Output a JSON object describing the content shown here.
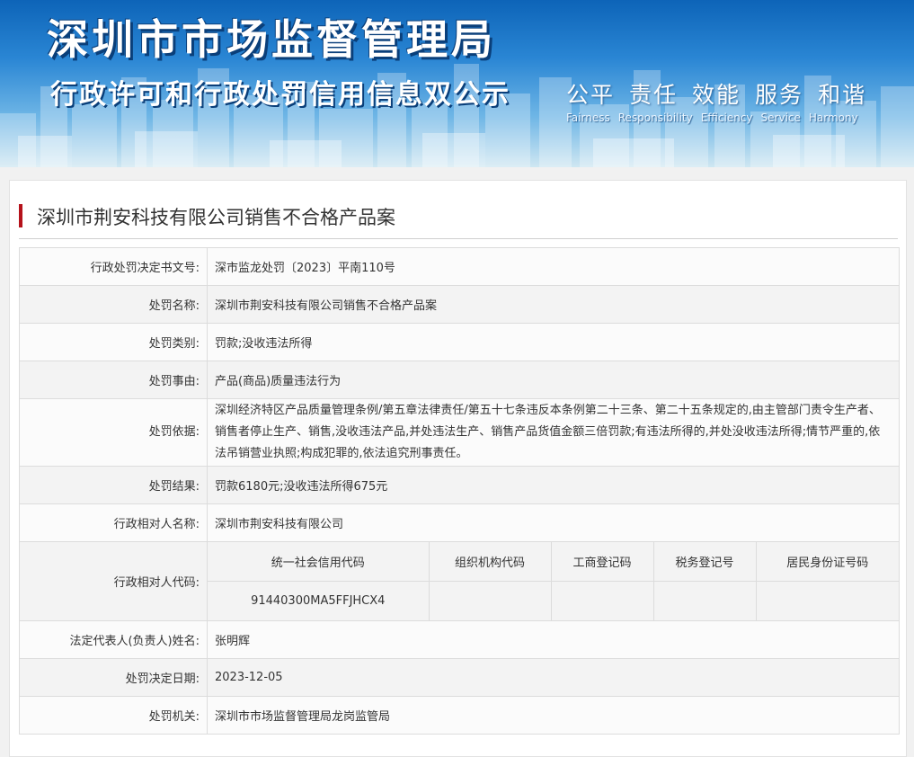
{
  "header": {
    "agency_name": "深圳市市场监督管理局",
    "subtitle": "行政许可和行政处罚信用信息双公示",
    "slogans_cn": [
      "公平",
      "责任",
      "效能",
      "服务",
      "和谐"
    ],
    "slogans_en": [
      "Fairness",
      "Responsibility",
      "Efficiency",
      "Service",
      "Harmony"
    ]
  },
  "case": {
    "title": "深圳市荆安科技有限公司销售不合格产品案",
    "fields": [
      {
        "label": "行政处罚决定书文号:",
        "value": "深市监龙处罚〔2023〕平南110号"
      },
      {
        "label": "处罚名称:",
        "value": "深圳市荆安科技有限公司销售不合格产品案"
      },
      {
        "label": "处罚类别:",
        "value": "罚款;没收违法所得"
      },
      {
        "label": "处罚事由:",
        "value": "产品(商品)质量违法行为"
      },
      {
        "label": "处罚依据:",
        "value": "深圳经济特区产品质量管理条例/第五章法律责任/第五十七条违反本条例第二十三条、第二十五条规定的,由主管部门责令生产者、销售者停止生产、销售,没收违法产品,并处违法生产、销售产品货值金额三倍罚款;有违法所得的,并处没收违法所得;情节严重的,依法吊销营业执照;构成犯罪的,依法追究刑事责任。"
      },
      {
        "label": "处罚结果:",
        "value": "罚款6180元;没收违法所得675元"
      },
      {
        "label": "行政相对人名称:",
        "value": "深圳市荆安科技有限公司"
      }
    ],
    "codes": {
      "label": "行政相对人代码:",
      "headers": [
        "统一社会信用代码",
        "组织机构代码",
        "工商登记码",
        "税务登记号",
        "居民身份证号码"
      ],
      "values": [
        "91440300MA5FFJHCX4",
        "",
        "",
        "",
        ""
      ]
    },
    "fields2": [
      {
        "label": "法定代表人(负责人)姓名:",
        "value": "张明辉"
      },
      {
        "label": "处罚决定日期:",
        "value": "2023-12-05"
      },
      {
        "label": "处罚机关:",
        "value": "深圳市市场监督管理局龙岗监管局"
      }
    ]
  },
  "colors": {
    "accent_bar": "#b5121b",
    "banner_top": "#0d64b8",
    "banner_bottom": "#cfe7f2"
  }
}
